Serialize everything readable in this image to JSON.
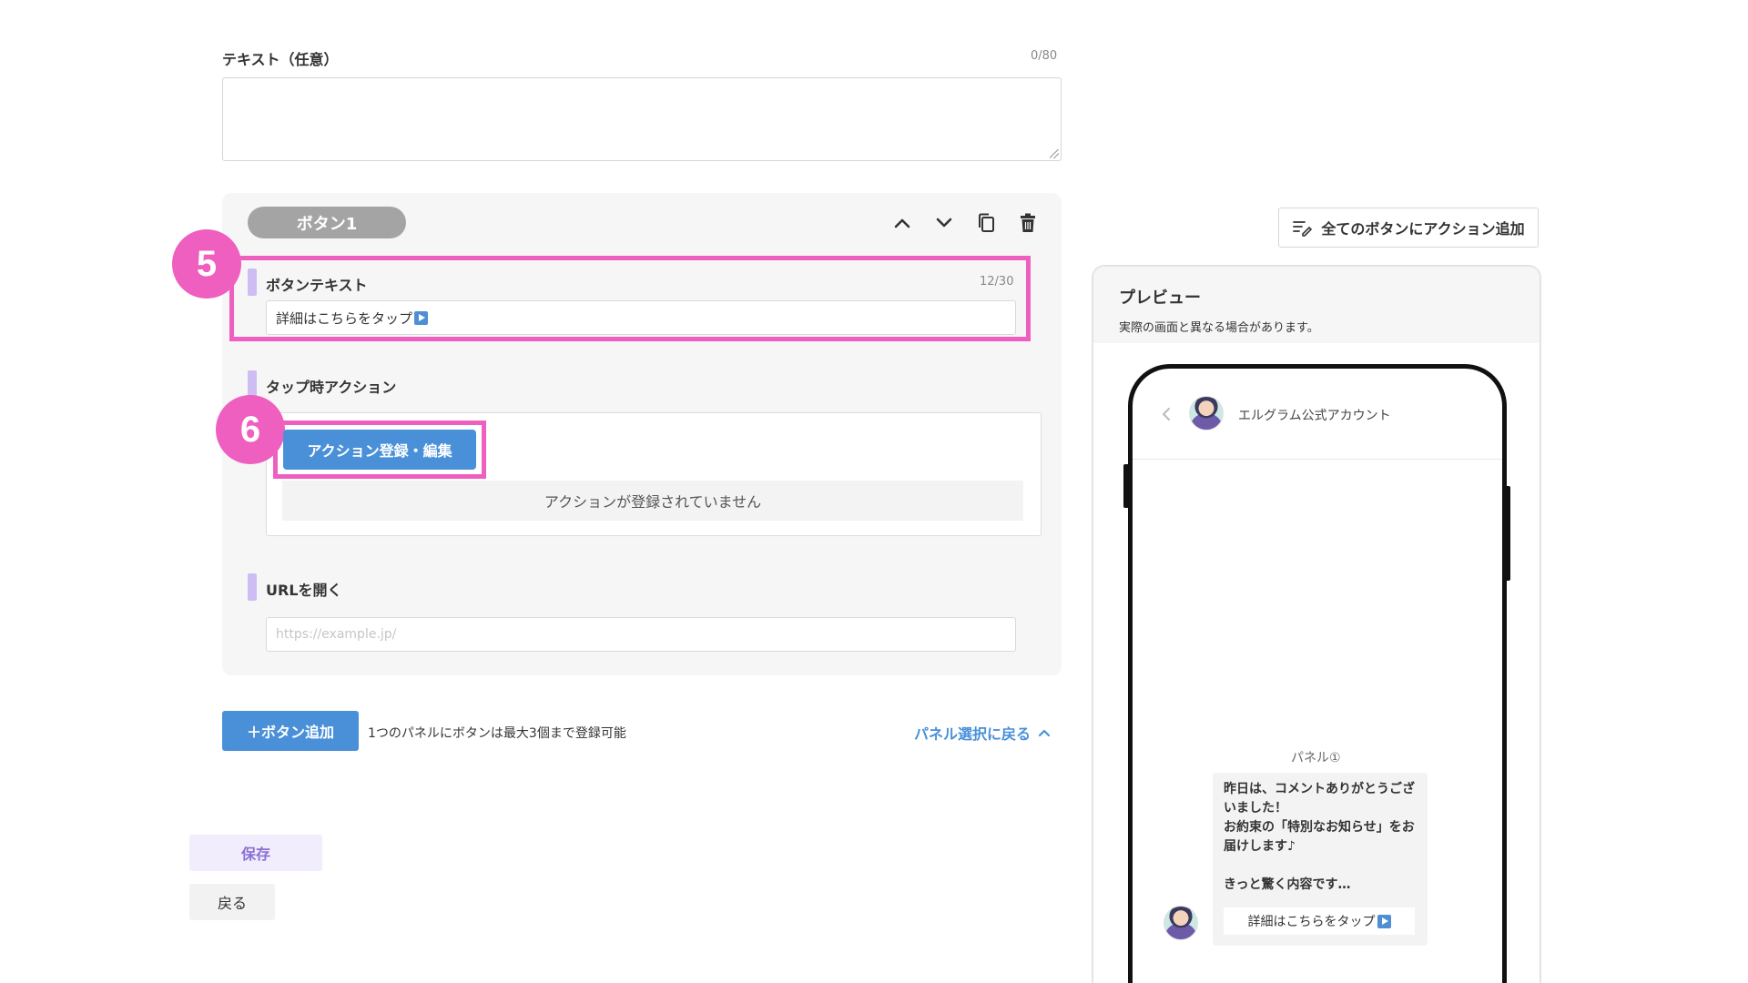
{
  "text_field": {
    "label": "テキスト（任意）",
    "counter": "0/80",
    "value": ""
  },
  "button_card": {
    "pill_label": "ボタン1",
    "button_text": {
      "label": "ボタンテキスト",
      "counter": "12/30",
      "value": "詳細はこちらをタップ"
    },
    "tap_action": {
      "label": "タップ時アクション",
      "register_label": "アクション登録・編集",
      "empty_text": "アクションが登録されていません"
    },
    "url": {
      "label": "URLを開く",
      "placeholder": "https://example.jp/"
    }
  },
  "steps": {
    "step5": "5",
    "step6": "6"
  },
  "footer": {
    "add_button": "＋ボタン追加",
    "note": "1つのパネルにボタンは最大3個まで登録可能",
    "back_to_panel": "パネル選択に戻る",
    "save": "保存",
    "back": "戻る"
  },
  "right": {
    "add_action_all": "全てのボタンにアクション追加",
    "preview_title": "プレビュー",
    "preview_note": "実際の画面と異なる場合があります。",
    "account_name": "エルグラム公式アカウント",
    "panel_label": "パネル①",
    "bubble_text": "昨日は、コメントありがとうございました！\nお約束の「特別なお知らせ」をお届けします♪\n\nきっと驚く内容です…",
    "bubble_button": "詳細はこちらをタップ"
  },
  "colors": {
    "highlight": "#ef5fbf",
    "primary_blue": "#4a90d9",
    "accent_lavender": "#cdbdf3"
  }
}
